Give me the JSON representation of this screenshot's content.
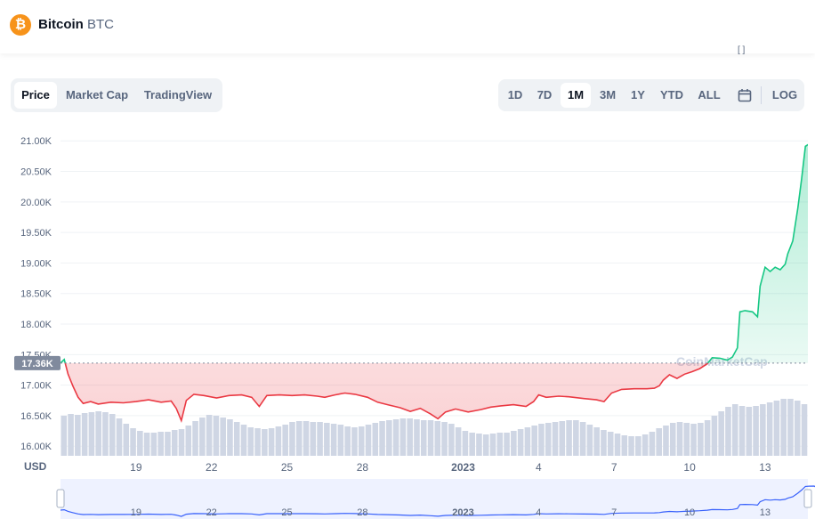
{
  "header": {
    "coin_icon_glyph": "₿",
    "coin_name": "Bitcoin",
    "coin_symbol": "BTC"
  },
  "tabs": [
    {
      "label": "Price",
      "active": true
    },
    {
      "label": "Market Cap",
      "active": false
    },
    {
      "label": "TradingView",
      "active": false
    }
  ],
  "ranges": [
    {
      "label": "1D",
      "active": false
    },
    {
      "label": "7D",
      "active": false
    },
    {
      "label": "1M",
      "active": true
    },
    {
      "label": "3M",
      "active": false
    },
    {
      "label": "1Y",
      "active": false
    },
    {
      "label": "YTD",
      "active": false
    },
    {
      "label": "ALL",
      "active": false
    }
  ],
  "calendar_icon": "calendar-icon",
  "log_label": "LOG",
  "colors": {
    "up": "#16c784",
    "down": "#ea3943",
    "volume": "#cfd6e4",
    "navigator": "#3861fb",
    "current_badge": "#808a9d"
  },
  "chart_data": {
    "type": "line",
    "currency_label": "USD",
    "watermark": "CoinMarketCap",
    "current_price_label": "17.36K",
    "baseline_price": 17360,
    "y_ticks": [
      "21.00K",
      "20.50K",
      "20.00K",
      "19.50K",
      "19.00K",
      "18.50K",
      "18.00K",
      "17.50K",
      "17.00K",
      "16.50K",
      "16.00K"
    ],
    "y_tick_values": [
      21000,
      20500,
      20000,
      19500,
      19000,
      18500,
      18000,
      17500,
      17000,
      16500,
      16000
    ],
    "x_ticks": [
      "19",
      "22",
      "25",
      "28",
      "2023",
      "4",
      "7",
      "10",
      "13"
    ],
    "x_tick_days": [
      2,
      5,
      8,
      11,
      15,
      18,
      21,
      24,
      27
    ],
    "x_range_days": [
      -1,
      28.7
    ],
    "y_range": [
      15770,
      21120
    ],
    "x_date_start": "Dec 17",
    "series": [
      {
        "values": [
          [
            -1.0,
            17360
          ],
          [
            -0.85,
            17420
          ],
          [
            -0.7,
            17180
          ],
          [
            -0.5,
            16980
          ],
          [
            -0.3,
            16800
          ],
          [
            -0.1,
            16700
          ],
          [
            0.2,
            16730
          ],
          [
            0.5,
            16690
          ],
          [
            1.0,
            16720
          ],
          [
            1.5,
            16710
          ],
          [
            2.0,
            16730
          ],
          [
            2.5,
            16760
          ],
          [
            3.0,
            16720
          ],
          [
            3.4,
            16740
          ],
          [
            3.6,
            16620
          ],
          [
            3.8,
            16420
          ],
          [
            4.0,
            16750
          ],
          [
            4.3,
            16850
          ],
          [
            4.7,
            16830
          ],
          [
            5.2,
            16790
          ],
          [
            5.7,
            16830
          ],
          [
            6.2,
            16840
          ],
          [
            6.6,
            16800
          ],
          [
            6.9,
            16650
          ],
          [
            7.2,
            16830
          ],
          [
            7.7,
            16840
          ],
          [
            8.2,
            16830
          ],
          [
            8.7,
            16840
          ],
          [
            9.2,
            16820
          ],
          [
            9.5,
            16800
          ],
          [
            9.9,
            16840
          ],
          [
            10.3,
            16870
          ],
          [
            10.7,
            16850
          ],
          [
            11.2,
            16800
          ],
          [
            11.6,
            16720
          ],
          [
            12.0,
            16680
          ],
          [
            12.5,
            16630
          ],
          [
            12.9,
            16570
          ],
          [
            13.3,
            16620
          ],
          [
            13.7,
            16530
          ],
          [
            14.0,
            16450
          ],
          [
            14.3,
            16560
          ],
          [
            14.7,
            16610
          ],
          [
            15.2,
            16560
          ],
          [
            15.7,
            16600
          ],
          [
            16.1,
            16640
          ],
          [
            16.5,
            16660
          ],
          [
            17.0,
            16680
          ],
          [
            17.5,
            16650
          ],
          [
            17.8,
            16730
          ],
          [
            18.0,
            16840
          ],
          [
            18.3,
            16800
          ],
          [
            18.8,
            16820
          ],
          [
            19.2,
            16810
          ],
          [
            19.8,
            16780
          ],
          [
            20.3,
            16760
          ],
          [
            20.6,
            16730
          ],
          [
            20.9,
            16870
          ],
          [
            21.3,
            16930
          ],
          [
            21.8,
            16940
          ],
          [
            22.3,
            16940
          ],
          [
            22.6,
            16950
          ],
          [
            22.8,
            16990
          ],
          [
            22.95,
            17080
          ],
          [
            23.2,
            17170
          ],
          [
            23.5,
            17110
          ],
          [
            23.8,
            17180
          ],
          [
            24.1,
            17220
          ],
          [
            24.4,
            17270
          ],
          [
            24.7,
            17350
          ],
          [
            24.9,
            17450
          ],
          [
            25.2,
            17440
          ],
          [
            25.5,
            17410
          ],
          [
            25.7,
            17460
          ],
          [
            25.9,
            17610
          ],
          [
            26.0,
            18200
          ],
          [
            26.2,
            18220
          ],
          [
            26.5,
            18200
          ],
          [
            26.7,
            18120
          ],
          [
            26.8,
            18620
          ],
          [
            27.0,
            18930
          ],
          [
            27.2,
            18860
          ],
          [
            27.4,
            18930
          ],
          [
            27.6,
            18890
          ],
          [
            27.8,
            18980
          ],
          [
            27.9,
            19150
          ],
          [
            28.1,
            19360
          ],
          [
            28.3,
            19900
          ],
          [
            28.45,
            20370
          ],
          [
            28.6,
            20910
          ],
          [
            28.75,
            20950
          ],
          [
            28.95,
            20960
          ],
          [
            29.1,
            20570
          ],
          [
            29.3,
            20870
          ],
          [
            29.5,
            20830
          ],
          [
            29.6,
            20810
          ],
          [
            29.8,
            20890
          ],
          [
            29.95,
            20860
          ],
          [
            30.05,
            21020
          ]
        ]
      }
    ],
    "volume": [
      0.45,
      0.47,
      0.46,
      0.48,
      0.49,
      0.5,
      0.49,
      0.47,
      0.42,
      0.36,
      0.31,
      0.28,
      0.26,
      0.26,
      0.27,
      0.27,
      0.29,
      0.3,
      0.34,
      0.39,
      0.43,
      0.46,
      0.45,
      0.43,
      0.41,
      0.38,
      0.35,
      0.32,
      0.31,
      0.3,
      0.31,
      0.33,
      0.35,
      0.38,
      0.39,
      0.39,
      0.38,
      0.38,
      0.37,
      0.36,
      0.35,
      0.33,
      0.32,
      0.33,
      0.35,
      0.37,
      0.39,
      0.4,
      0.41,
      0.42,
      0.42,
      0.41,
      0.4,
      0.4,
      0.39,
      0.38,
      0.36,
      0.32,
      0.28,
      0.26,
      0.25,
      0.24,
      0.25,
      0.26,
      0.26,
      0.28,
      0.3,
      0.32,
      0.34,
      0.36,
      0.37,
      0.38,
      0.39,
      0.4,
      0.4,
      0.38,
      0.35,
      0.32,
      0.29,
      0.27,
      0.25,
      0.23,
      0.22,
      0.22,
      0.24,
      0.27,
      0.31,
      0.34,
      0.37,
      0.38,
      0.37,
      0.36,
      0.37,
      0.4,
      0.45,
      0.5,
      0.55,
      0.58,
      0.56,
      0.55,
      0.56,
      0.58,
      0.6,
      0.62,
      0.64,
      0.64,
      0.62,
      0.58
    ],
    "navigator_labels": [
      "19",
      "22",
      "25",
      "28",
      "2023",
      "4",
      "7",
      "10",
      "13"
    ]
  }
}
